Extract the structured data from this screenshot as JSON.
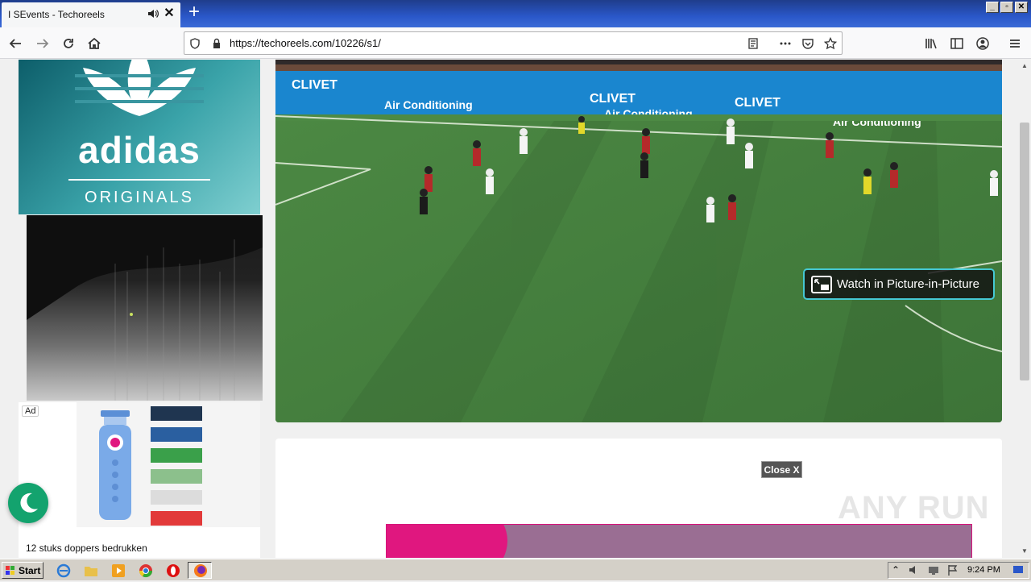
{
  "browser": {
    "tab_title": "I SEvents - Techoreels",
    "url": "https://techoreels.com/10226/s1/"
  },
  "sidebar": {
    "adidas": {
      "wordmark": "adidas",
      "sub": "ORIGINALS"
    },
    "ad": {
      "label": "Ad",
      "caption": "12 stuks doppers bedrukken"
    }
  },
  "video": {
    "pip_label": "Watch in Picture-in-Picture",
    "board_texts": [
      "CLIVET",
      "Air Conditioning",
      "CLIVET",
      "Air Conditioning",
      "CLIVET",
      "Air Conditioning"
    ]
  },
  "panel": {
    "close_label": "Close X"
  },
  "watermark": "ANY RUN",
  "taskbar": {
    "start_label": "Start",
    "time": "9:24 PM"
  },
  "colors": {
    "tabbar": "#2a57c9",
    "pitch": "#3f7a3a",
    "pip_border": "#45c8d3",
    "moon_button": "#13a36e",
    "banner": "#9a6e93",
    "banner_accent": "#e0177f"
  }
}
